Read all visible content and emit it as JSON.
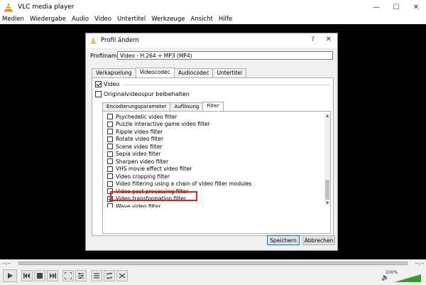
{
  "app": {
    "title": "VLC media player"
  },
  "menubar": {
    "items": [
      "Medien",
      "Wiedergabe",
      "Audio",
      "Video",
      "Untertitel",
      "Werkzeuge",
      "Ansicht",
      "Hilfe"
    ]
  },
  "player": {
    "time_left": "--:--",
    "time_right": "--:--",
    "volume": "100%",
    "volume_level": 1.0
  },
  "dialog": {
    "title": "Profil ändern",
    "help": "?",
    "profile_label": "Profilname",
    "profile_value": "Video - H.264 + MP3 (MP4)",
    "tabs": [
      "Verkapselung",
      "Videocodec",
      "Audiocodec",
      "Untertitel"
    ],
    "active_tab": "Videocodec",
    "video_label": "Video",
    "video_checked": true,
    "keep_original_label": "Originalvideospur beibehalten",
    "keep_original_checked": false,
    "subtabs": [
      "Encodierungsparameter",
      "Auflösung",
      "Filter"
    ],
    "active_subtab": "Filter",
    "filters": [
      {
        "label": "Psychedelic video filter",
        "checked": false
      },
      {
        "label": "Puzzle interactive game video filter",
        "checked": false
      },
      {
        "label": "Ripple video filter",
        "checked": false
      },
      {
        "label": "Rotate video filter",
        "checked": false
      },
      {
        "label": "Scene video filter",
        "checked": false
      },
      {
        "label": "Sepia video filter",
        "checked": false
      },
      {
        "label": "Sharpen video filter",
        "checked": false
      },
      {
        "label": "VHS movie effect video filter",
        "checked": false
      },
      {
        "label": "Video cropping filter",
        "checked": false
      },
      {
        "label": "Video filtering using a chain of video filter modules",
        "checked": false
      },
      {
        "label": "Video post processing filter",
        "checked": false
      },
      {
        "label": "Video transformation filter",
        "checked": true
      },
      {
        "label": "Wave video filter",
        "checked": false
      }
    ],
    "save_label": "Speichern",
    "cancel_label": "Abbrechen"
  }
}
